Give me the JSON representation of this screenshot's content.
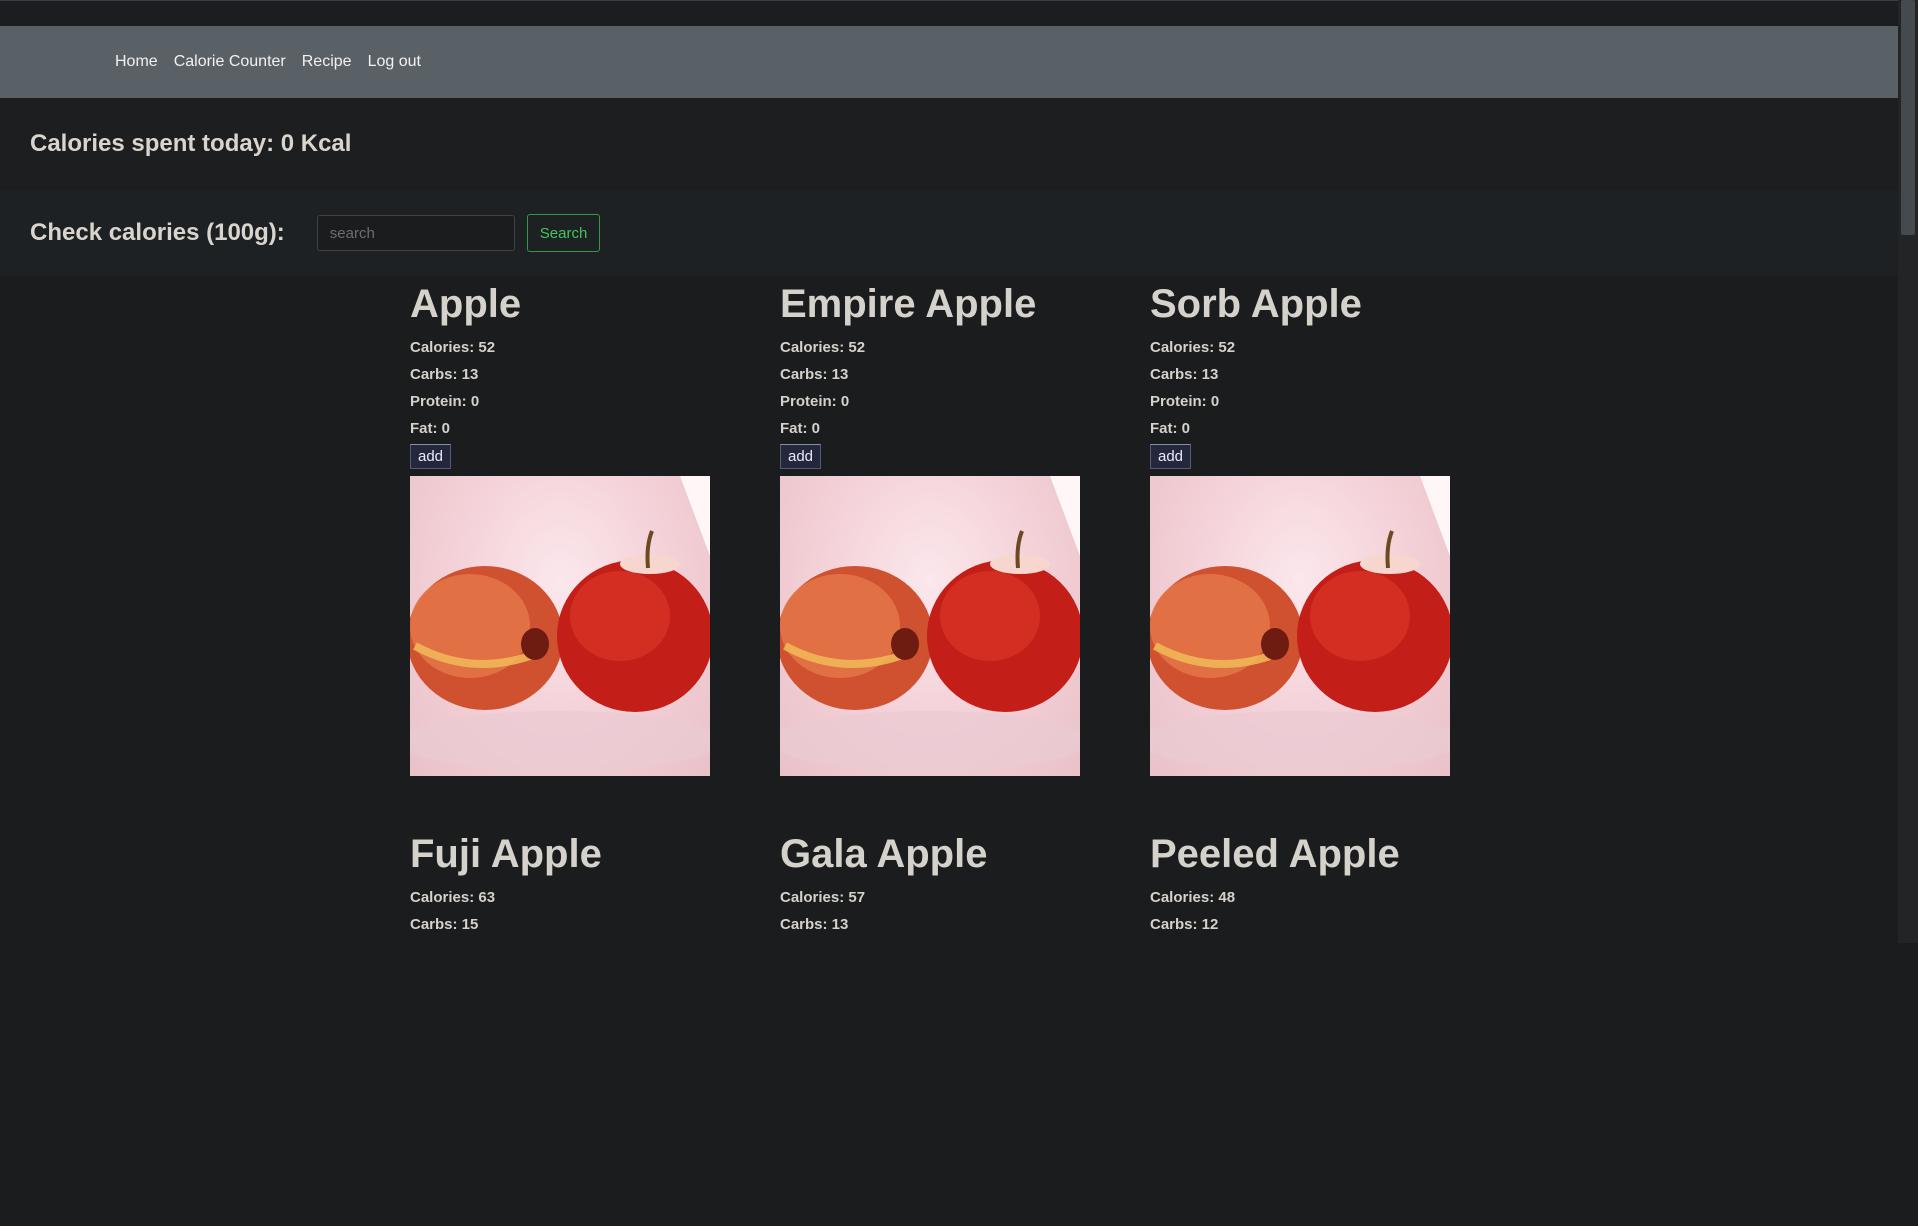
{
  "nav": {
    "links": [
      "Home",
      "Calorie Counter",
      "Recipe",
      "Log out"
    ]
  },
  "summary": {
    "calories_text": "Calories spent today: 0 Kcal"
  },
  "search": {
    "label": "Check calories (100g):",
    "placeholder": "search",
    "button_label": "Search"
  },
  "foods": [
    {
      "name": "Apple",
      "calories": "Calories: 52",
      "carbs": "Carbs: 13",
      "protein": "Protein: 0",
      "fat": "Fat: 0",
      "add_label": "add",
      "image_icon": "apples-photo"
    },
    {
      "name": "Empire Apple",
      "calories": "Calories: 52",
      "carbs": "Carbs: 13",
      "protein": "Protein: 0",
      "fat": "Fat: 0",
      "add_label": "add",
      "image_icon": "apples-photo"
    },
    {
      "name": "Sorb Apple",
      "calories": "Calories: 52",
      "carbs": "Carbs: 13",
      "protein": "Protein: 0",
      "fat": "Fat: 0",
      "add_label": "add",
      "image_icon": "apples-photo"
    },
    {
      "name": "Fuji Apple",
      "calories": "Calories: 63",
      "carbs": "Carbs: 15"
    },
    {
      "name": "Gala Apple",
      "calories": "Calories: 57",
      "carbs": "Carbs: 13"
    },
    {
      "name": "Peeled Apple",
      "calories": "Calories: 48",
      "carbs": "Carbs: 12"
    }
  ],
  "colors": {
    "background": "#1a1c1e",
    "navbar": "#5a6166",
    "search_button": "#48c15f",
    "add_button": "#24283c"
  }
}
